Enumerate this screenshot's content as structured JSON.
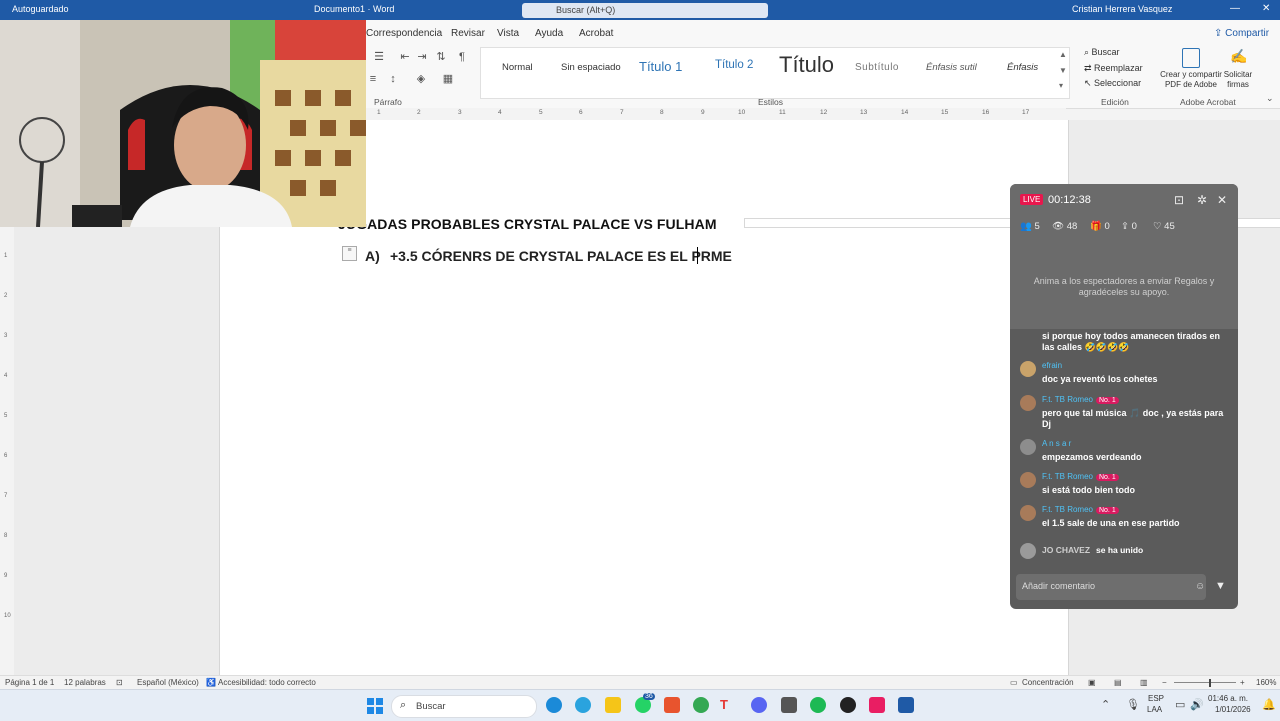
{
  "titlebar": {
    "autosave": "Autoguardado",
    "doc_name": "Documento1 · Word",
    "search": "Buscar (Alt+Q)",
    "user": "Cristian Herrera Vasquez"
  },
  "ribbon": {
    "tabs": [
      "Correspondencia",
      "Revisar",
      "Vista",
      "Ayuda",
      "Acrobat"
    ],
    "share": "Compartir",
    "styles": [
      "Normal",
      "Sin espaciado",
      "Título 1",
      "Título 2",
      "Título",
      "Subtítulo",
      "Énfasis sutil",
      "Énfasis"
    ],
    "groups": {
      "paragraph": "Párrafo",
      "styles": "Estilos",
      "editing": "Edición",
      "adobe": "Adobe Acrobat"
    },
    "editing": {
      "find": "Buscar",
      "replace": "Reemplazar",
      "select": "Seleccionar"
    },
    "adobe": {
      "create_share": "Crear y compartir PDF de Adobe",
      "request_sign": "Solicitar firmas"
    }
  },
  "ruler": {
    "ticks": [
      "1",
      "2",
      "3",
      "4",
      "5",
      "6",
      "7",
      "8",
      "9",
      "10",
      "11",
      "12",
      "13",
      "14",
      "15",
      "16",
      "17"
    ]
  },
  "document": {
    "title": "JUGADAS PROBABLES CRYSTAL PALACE VS FULHAM",
    "list_marker": "A)",
    "list_text": "+3.5 CÓRENRS DE CRYSTAL PALACE ES EL PRME"
  },
  "live": {
    "badge": "LIVE",
    "timer": "00:12:38",
    "stats": {
      "viewers_now": "5",
      "views": "48",
      "gifts": "0",
      "shares": "0",
      "likes": "45"
    },
    "gift_hint": "Anima a los espectadores a enviar Regalos y agradéceles su apoyo.",
    "messages": [
      {
        "user": "",
        "text": "si porque hoy todos amanecen tirados en las calles 🤣🤣🤣🤣"
      },
      {
        "user": "efrain",
        "text": "doc ya reventó los cohetes"
      },
      {
        "user": "F.t. TB Romeo",
        "badge": "No. 1",
        "text": "pero que tal música 🎵 doc , ya estás para Dj"
      },
      {
        "user": "A n s a r",
        "text": "empezamos verdeando"
      },
      {
        "user": "F.t. TB Romeo",
        "badge": "No. 1",
        "text": "si está todo bien todo"
      },
      {
        "user": "F.t. TB Romeo",
        "badge": "No. 1",
        "text": "el 1.5 sale de una en ese partido"
      }
    ],
    "join": {
      "user": "JO CHAVEZ",
      "text": "se ha unido"
    },
    "comment_placeholder": "Añadir comentario"
  },
  "status": {
    "page": "Página 1 de 1",
    "words": "12 palabras",
    "language": "Español (México)",
    "accessibility": "Accesibilidad: todo correcto",
    "focus": "Concentración",
    "zoom": "160%"
  },
  "taskbar": {
    "search": "Buscar",
    "lang1": "ESP",
    "lang2": "LAA",
    "time": "01:46 a. m.",
    "date": "1/01/2026",
    "whatsapp_badge": "36"
  },
  "colors": {
    "word_blue": "#1f5aa6",
    "live_red": "#e8174d"
  }
}
